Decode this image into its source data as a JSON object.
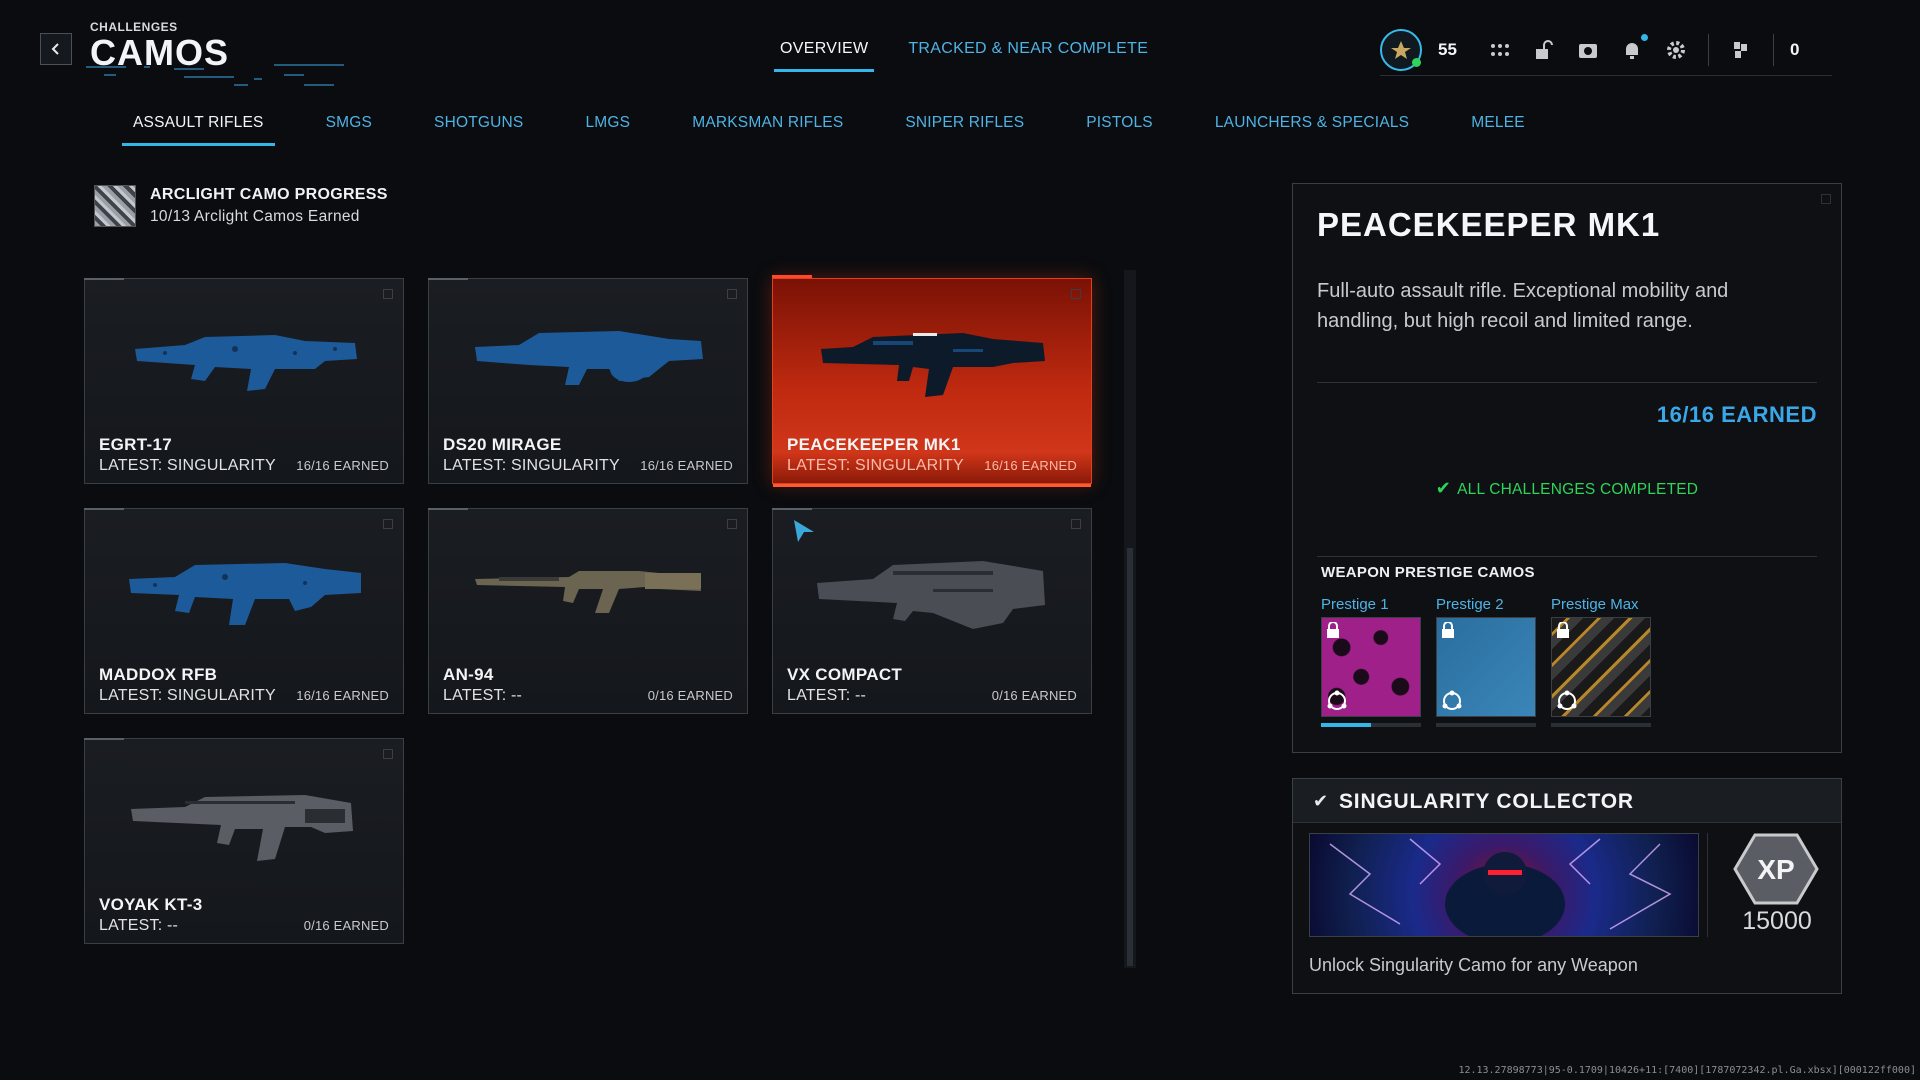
{
  "header": {
    "back_icon": "chevron-left-icon",
    "subtitle": "CHALLENGES",
    "title": "CAMOS",
    "tabs": [
      {
        "label": "OVERVIEW",
        "active": true
      },
      {
        "label": "TRACKED & NEAR COMPLETE",
        "active": false
      }
    ]
  },
  "hud": {
    "rank": "55",
    "currency": "0",
    "icons": [
      "rank-emblem-icon",
      "grid-menu-icon",
      "unlock-icon",
      "camera-icon",
      "bell-icon",
      "gear-icon",
      "currency-icon"
    ]
  },
  "categories": [
    {
      "label": "ASSAULT RIFLES",
      "active": true
    },
    {
      "label": "SMGS",
      "active": false
    },
    {
      "label": "SHOTGUNS",
      "active": false
    },
    {
      "label": "LMGS",
      "active": false
    },
    {
      "label": "MARKSMAN RIFLES",
      "active": false
    },
    {
      "label": "SNIPER RIFLES",
      "active": false
    },
    {
      "label": "PISTOLS",
      "active": false
    },
    {
      "label": "LAUNCHERS & SPECIALS",
      "active": false
    },
    {
      "label": "MELEE",
      "active": false
    }
  ],
  "arclight": {
    "title": "ARCLIGHT CAMO PROGRESS",
    "progress": "10/13 Arclight Camos Earned"
  },
  "weapons": [
    {
      "name": "EGRT-17",
      "latest": "LATEST: SINGULARITY",
      "earned": "16/16 EARNED",
      "camo": "singularity",
      "selected": false
    },
    {
      "name": "DS20 MIRAGE",
      "latest": "LATEST: SINGULARITY",
      "earned": "16/16 EARNED",
      "camo": "singularity",
      "selected": false
    },
    {
      "name": "PEACEKEEPER MK1",
      "latest": "LATEST: SINGULARITY",
      "earned": "16/16 EARNED",
      "camo": "singularity",
      "selected": true
    },
    {
      "name": "MADDOX RFB",
      "latest": "LATEST: SINGULARITY",
      "earned": "16/16 EARNED",
      "camo": "singularity",
      "selected": false
    },
    {
      "name": "AN-94",
      "latest": "LATEST: --",
      "earned": "0/16 EARNED",
      "camo": "none",
      "selected": false
    },
    {
      "name": "VX COMPACT",
      "latest": "LATEST: --",
      "earned": "0/16 EARNED",
      "camo": "none",
      "selected": false
    },
    {
      "name": "VOYAK KT-3",
      "latest": "LATEST: --",
      "earned": "0/16 EARNED",
      "camo": "none",
      "selected": false
    }
  ],
  "detail": {
    "title": "PEACEKEEPER MK1",
    "description": "Full-auto assault rifle. Exceptional mobility and handling, but high recoil and limited range.",
    "earned": "16/16 EARNED",
    "status": "ALL CHALLENGES COMPLETED",
    "prestige_title": "WEAPON PRESTIGE CAMOS",
    "prestige": [
      {
        "label": "Prestige 1",
        "locked": true,
        "progress": 0.5
      },
      {
        "label": "Prestige 2",
        "locked": true,
        "progress": 0
      },
      {
        "label": "Prestige Max",
        "locked": true,
        "progress": 0
      }
    ]
  },
  "collector": {
    "title": "SINGULARITY COLLECTOR",
    "xp_label": "XP",
    "xp": "15000",
    "description": "Unlock Singularity Camo for any Weapon"
  },
  "build": "12.13.27898773|95-0.1709|10426+11:[7400][1787072342.pl.Ga.xbsx][000122ff000]",
  "colors": {
    "accent": "#35b6e8",
    "link": "#4fb3e6",
    "selected": "#c02a10",
    "success": "#2fd45a"
  }
}
